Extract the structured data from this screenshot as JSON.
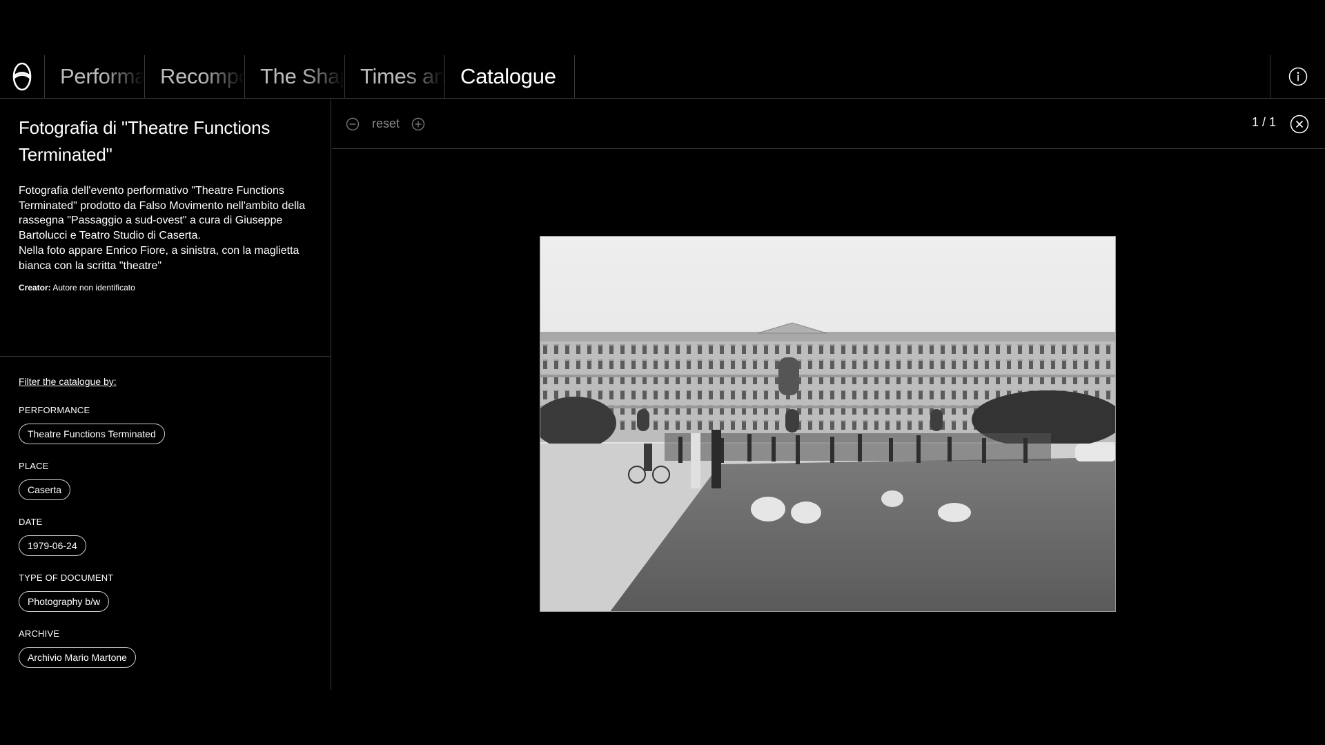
{
  "nav": {
    "tabs": [
      {
        "label": "Performances"
      },
      {
        "label": "Recompositions"
      },
      {
        "label": "The Shape"
      },
      {
        "label": "Times and"
      },
      {
        "label": "Catalogue"
      }
    ],
    "logo_icon": "loop-logo-icon",
    "info_icon": "info-icon"
  },
  "detail": {
    "title": "Fotografia di \"Theatre Functions Terminated\"",
    "description_line1": "Fotografia dell'evento performativo \"Theatre Functions Terminated\" prodotto da Falso Movimento nell'ambito della rassegna \"Passaggio a sud-ovest\" a cura di Giuseppe Bartolucci e Teatro Studio di Caserta.",
    "description_line2": "Nella foto appare Enrico Fiore, a sinistra, con la maglietta bianca con la scritta \"theatre\"",
    "creator_label": "Creator:",
    "creator_value": "Autore non identificato"
  },
  "filters": {
    "title": "Filter the catalogue by:",
    "groups": [
      {
        "label": "PERFORMANCE",
        "value": "Theatre Functions Terminated"
      },
      {
        "label": "PLACE",
        "value": "Caserta"
      },
      {
        "label": "DATE",
        "value": "1979-06-24"
      },
      {
        "label": "TYPE OF DOCUMENT",
        "value": "Photography b/w"
      },
      {
        "label": "ARCHIVE",
        "value": "Archivio Mario Martone"
      }
    ]
  },
  "viewer": {
    "reset_label": "reset",
    "page_counter": "1 / 1",
    "icons": [
      "zoom-out-icon",
      "zoom-in-icon",
      "close-icon"
    ]
  },
  "colors": {
    "background": "#000000",
    "divider": "#3a3a3a",
    "muted_text": "#8a8a8a"
  }
}
